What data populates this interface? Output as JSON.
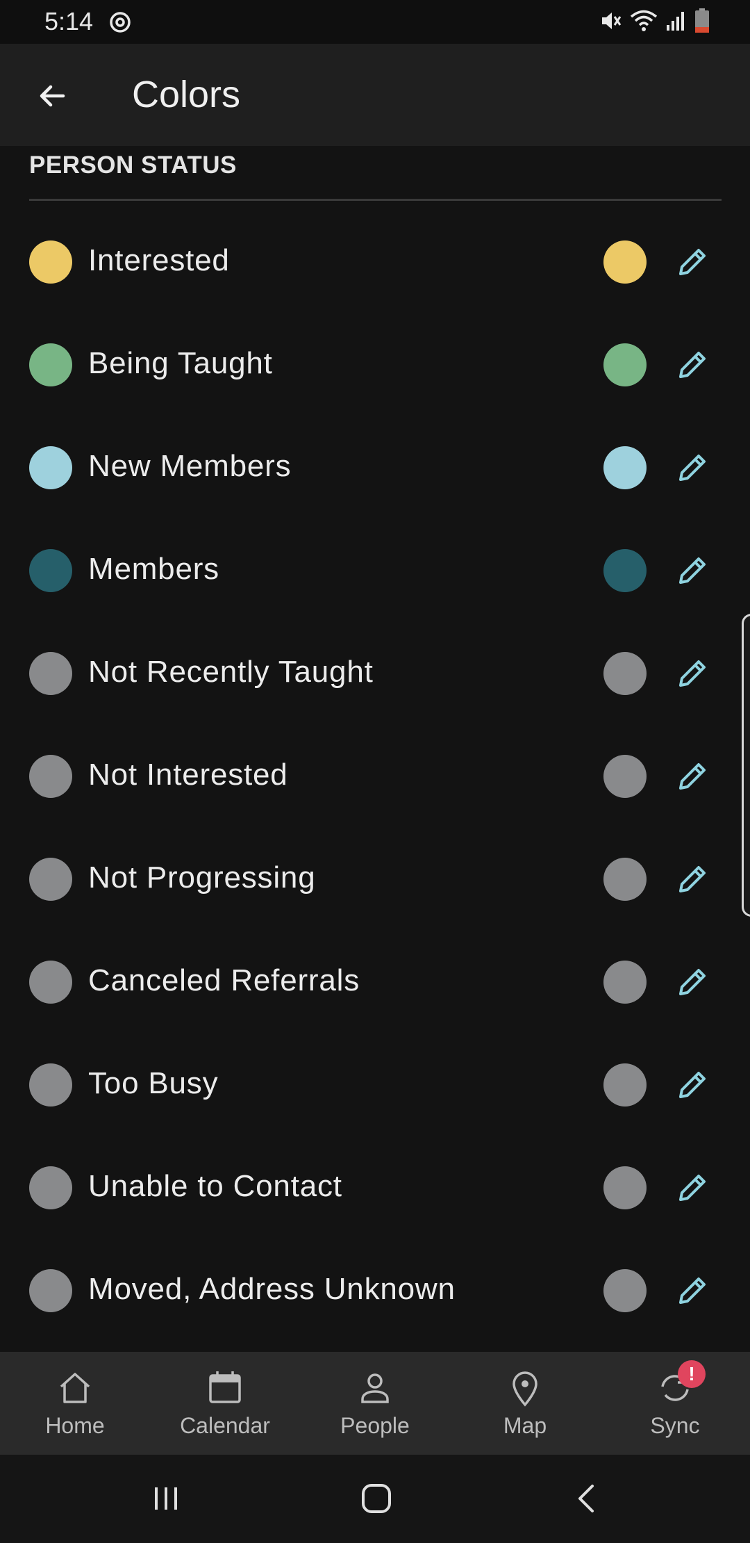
{
  "status_bar": {
    "time": "5:14",
    "icons": [
      "sync-status-icon",
      "mute-icon",
      "wifi-icon",
      "signal-icon",
      "battery-low-icon"
    ]
  },
  "app_bar": {
    "title": "Colors",
    "back_icon": "arrow-left-icon"
  },
  "section": {
    "header": "PERSON STATUS"
  },
  "statuses": [
    {
      "label": "Interested",
      "color": "#ecc966"
    },
    {
      "label": "Being Taught",
      "color": "#78b585"
    },
    {
      "label": "New Members",
      "color": "#9ed1dd"
    },
    {
      "label": "Members",
      "color": "#265f6a"
    },
    {
      "label": "Not Recently Taught",
      "color": "#898a8c"
    },
    {
      "label": "Not Interested",
      "color": "#898a8c"
    },
    {
      "label": "Not Progressing",
      "color": "#898a8c"
    },
    {
      "label": "Canceled Referrals",
      "color": "#898a8c"
    },
    {
      "label": "Too Busy",
      "color": "#898a8c"
    },
    {
      "label": "Unable to Contact",
      "color": "#898a8c"
    },
    {
      "label": "Moved, Address Unknown",
      "color": "#898a8c"
    }
  ],
  "edit_icon": "pencil-icon",
  "accent_color": "#8fd3e0",
  "bottom_nav": {
    "items": [
      {
        "label": "Home",
        "icon": "home-icon"
      },
      {
        "label": "Calendar",
        "icon": "calendar-icon"
      },
      {
        "label": "People",
        "icon": "person-icon"
      },
      {
        "label": "Map",
        "icon": "map-pin-icon"
      },
      {
        "label": "Sync",
        "icon": "sync-icon",
        "badge": "!"
      }
    ]
  },
  "system_nav": {
    "icons": [
      "recents-icon",
      "home-circle-icon",
      "back-chevron-icon"
    ]
  }
}
